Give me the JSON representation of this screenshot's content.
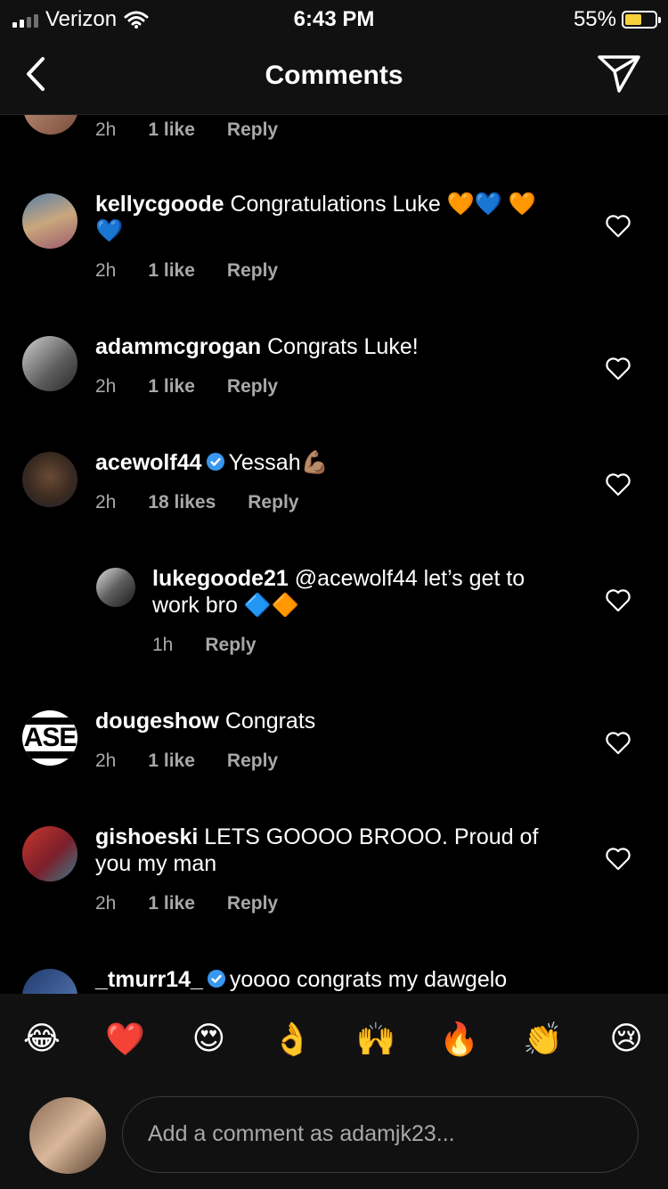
{
  "status": {
    "carrier": "Verizon",
    "time": "6:43 PM",
    "battery": "55%",
    "battery_level": 0.55
  },
  "nav": {
    "title": "Comments"
  },
  "partial_top": {
    "time": "2h",
    "likes": "1 like",
    "reply": "Reply"
  },
  "comments": [
    {
      "user": "kellycgoode",
      "text": "Congratulations Luke 🧡💙 🧡💙",
      "time": "2h",
      "likes": "1 like",
      "reply": "Reply",
      "verified": false
    },
    {
      "user": "adammcgrogan",
      "text": "Congrats Luke!",
      "time": "2h",
      "likes": "1 like",
      "reply": "Reply",
      "verified": false
    },
    {
      "user": "acewolf44",
      "text": "Yessah💪🏽",
      "time": "2h",
      "likes": "18 likes",
      "reply": "Reply",
      "verified": true
    },
    {
      "user": "lukegoode21",
      "text": "@acewolf44 let’s get to work bro 🔷🔶",
      "time": "1h",
      "likes": "",
      "reply": "Reply",
      "verified": false
    },
    {
      "user": "dougeshow",
      "text": "Congrats",
      "time": "2h",
      "likes": "1 like",
      "reply": "Reply",
      "verified": false
    },
    {
      "user": "gishoeski",
      "text": "LETS GOOOO BROOO. Proud of you my man",
      "time": "2h",
      "likes": "1 like",
      "reply": "Reply",
      "verified": false
    },
    {
      "user": "_tmurr14_",
      "text": "yoooo congrats my dawgelo",
      "time": "",
      "likes": "",
      "reply": "",
      "verified": true
    }
  ],
  "emoji_bar": [
    "😂",
    "❤️",
    "😍",
    "👌",
    "🙌",
    "🔥",
    "👏",
    "😢"
  ],
  "input": {
    "placeholder": "Add a comment as adamjk23..."
  },
  "dougeshow_logo_text": "ASE",
  "colors": {
    "background": "#000000",
    "meta": "#a8a8a8",
    "verified": "#3897f0",
    "battery": "#f7d13a"
  }
}
